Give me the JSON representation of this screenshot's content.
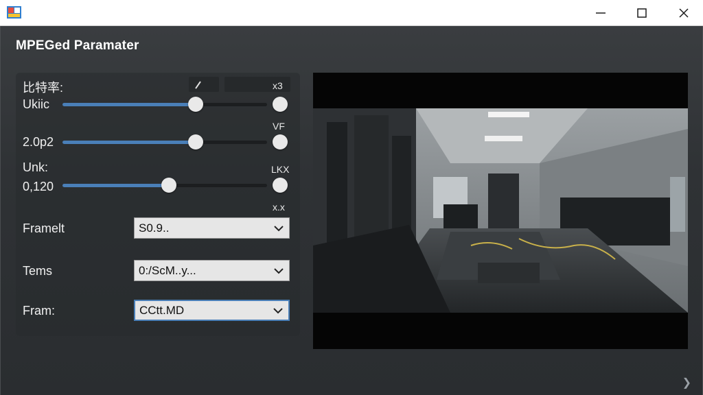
{
  "window": {
    "minimize_icon": "minimize-icon",
    "maximize_icon": "maximize-icon",
    "close_icon": "close-icon"
  },
  "dialog": {
    "title": "MPEGed Paramater"
  },
  "sliders": [
    {
      "label_top": "比特率:",
      "label": "Ukiic",
      "value": 0.65,
      "right_label": "x3",
      "top_label": ""
    },
    {
      "label_top": "",
      "label": "2.0p2",
      "value": 0.65,
      "right_label": "",
      "top_label": "VF"
    },
    {
      "label_top": "Unk:",
      "label": "0,120",
      "value": 0.52,
      "right_label": "LKX",
      "top_label": ""
    }
  ],
  "slider3_bottom_label": "x.x",
  "mini_box_icon": "pencil-icon",
  "fields": [
    {
      "label": "Framelt",
      "value": "S0.9.."
    },
    {
      "label": "Tems",
      "value": "0:/ScM..y..."
    },
    {
      "label": "Fram:",
      "value": "CCtt.MD"
    }
  ],
  "colors": {
    "accent": "#4a7fb8",
    "panel_bg": "#2f3235",
    "titlebar_bg": "#ffffff"
  }
}
